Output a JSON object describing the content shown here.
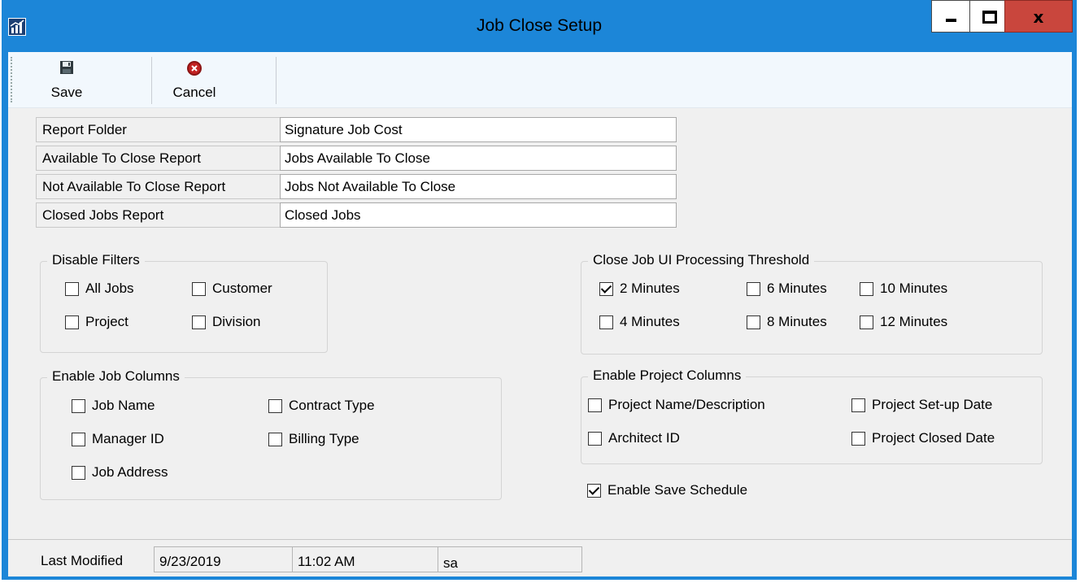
{
  "window": {
    "title": "Job Close Setup",
    "close_glyph": "x"
  },
  "toolbar": {
    "save_label": "Save",
    "cancel_label": "Cancel"
  },
  "fields": [
    {
      "label": "Report Folder",
      "value": "Signature Job Cost"
    },
    {
      "label": "Available To Close Report",
      "value": "Jobs Available To Close"
    },
    {
      "label": "Not Available To Close Report",
      "value": "Jobs Not Available To Close"
    },
    {
      "label": "Closed Jobs Report",
      "value": "Closed Jobs"
    }
  ],
  "disable_filters": {
    "title": "Disable Filters",
    "options": [
      {
        "label": "All Jobs",
        "checked": false
      },
      {
        "label": "Customer",
        "checked": false
      },
      {
        "label": "Project",
        "checked": false
      },
      {
        "label": "Division",
        "checked": false
      }
    ]
  },
  "threshold": {
    "title": "Close Job UI Processing Threshold",
    "options": [
      {
        "label": "2 Minutes",
        "checked": true
      },
      {
        "label": "6 Minutes",
        "checked": false
      },
      {
        "label": "10 Minutes",
        "checked": false
      },
      {
        "label": "4 Minutes",
        "checked": false
      },
      {
        "label": "8 Minutes",
        "checked": false
      },
      {
        "label": "12 Minutes",
        "checked": false
      }
    ]
  },
  "job_columns": {
    "title": "Enable Job Columns",
    "options": [
      {
        "label": "Job Name",
        "checked": false
      },
      {
        "label": "Contract Type",
        "checked": false
      },
      {
        "label": "Manager ID",
        "checked": false
      },
      {
        "label": "Billing Type",
        "checked": false
      },
      {
        "label": "Job Address",
        "checked": false
      }
    ]
  },
  "project_columns": {
    "title": "Enable Project Columns",
    "options": [
      {
        "label": "Project Name/Description",
        "checked": false
      },
      {
        "label": "Project Set-up Date",
        "checked": false
      },
      {
        "label": "Architect ID",
        "checked": false
      },
      {
        "label": "Project Closed Date",
        "checked": false
      }
    ]
  },
  "save_schedule": {
    "label": "Enable Save Schedule",
    "checked": true
  },
  "status": {
    "label": "Last Modified",
    "date": "9/23/2019",
    "time": "11:02 AM",
    "user": "sa"
  },
  "colors": {
    "titlebar": "#1c86d8",
    "close_button": "#c9463d",
    "toolbar_bg": "#f2f8fd",
    "client_bg": "#f0f0f0"
  }
}
